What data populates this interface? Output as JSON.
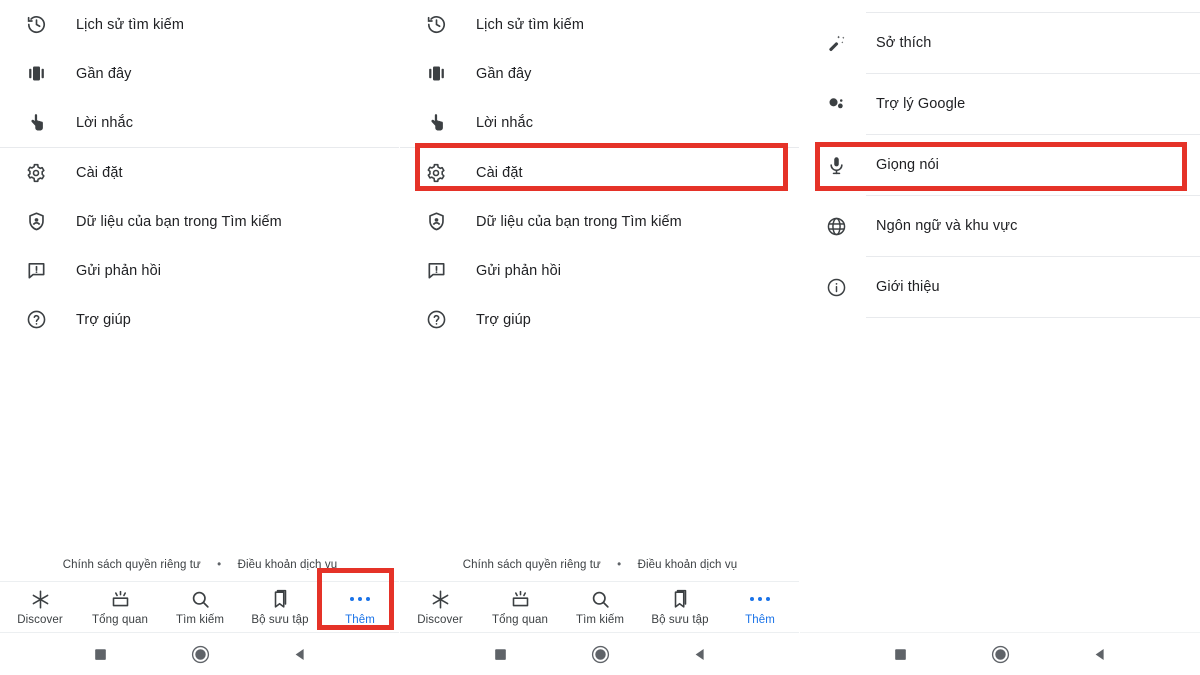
{
  "app": {
    "accent_blue": "#1a73e8",
    "highlight_red": "#e53228",
    "text_color": "#202124"
  },
  "menu_panel": {
    "group_one": [
      {
        "label": "Lịch sử tìm kiếm",
        "icon": "history-clock-icon"
      },
      {
        "label": "Gần đây",
        "icon": "recent-cards-icon"
      },
      {
        "label": "Lời nhắc",
        "icon": "reminder-hand-icon"
      }
    ],
    "group_two": [
      {
        "label": "Cài đặt",
        "icon": "gear-icon"
      },
      {
        "label": "Dữ liệu của bạn trong Tìm kiếm",
        "icon": "shield-person-icon"
      },
      {
        "label": "Gửi phản hồi",
        "icon": "feedback-icon"
      },
      {
        "label": "Trợ giúp",
        "icon": "help-circle-icon"
      }
    ]
  },
  "footer": {
    "privacy_label": "Chính sách quyền riêng tư",
    "separator": "•",
    "terms_label": "Điều khoản dịch vụ"
  },
  "tabbar": {
    "tabs": [
      {
        "label": "Discover",
        "icon": "asterisk-icon",
        "active": false
      },
      {
        "label": "Tổng quan",
        "icon": "snapshot-icon",
        "active": false
      },
      {
        "label": "Tìm kiếm",
        "icon": "search-icon",
        "active": false
      },
      {
        "label": "Bộ sưu tập",
        "icon": "bookmark-icon",
        "active": false
      },
      {
        "label": "Thêm",
        "icon": "more-dots-icon",
        "active": true
      }
    ]
  },
  "settings_panel": {
    "items": [
      {
        "label": "Sở thích",
        "icon": "magic-wand-icon"
      },
      {
        "label": "Trợ lý Google",
        "icon": "google-assistant-icon"
      },
      {
        "label": "Giọng nói",
        "icon": "microphone-icon"
      },
      {
        "label": "Ngôn ngữ và khu vực",
        "icon": "globe-icon"
      },
      {
        "label": "Giới thiệu",
        "icon": "info-circle-icon"
      }
    ]
  },
  "system_nav": {
    "buttons": [
      {
        "name": "recents-square-icon"
      },
      {
        "name": "home-circle-icon"
      },
      {
        "name": "back-triangle-icon"
      }
    ]
  },
  "annotations": {
    "settings_item_box": "Cài đặt",
    "more_tab_box": "Thêm",
    "voice_item_box": "Giọng nói"
  }
}
